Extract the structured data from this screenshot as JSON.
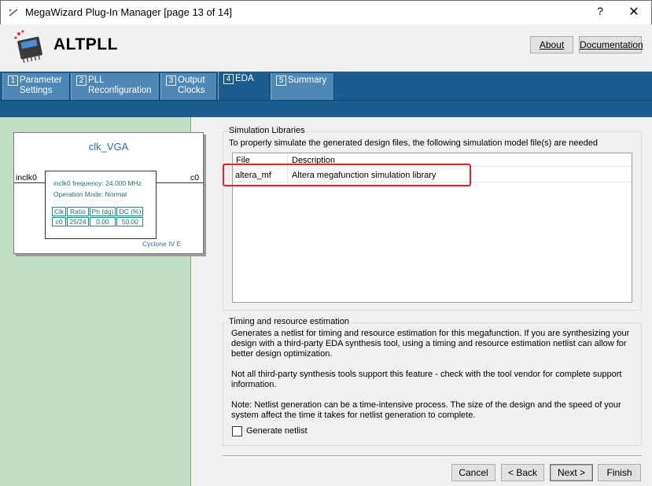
{
  "window": {
    "title": "MegaWizard Plug-In Manager [page 13 of 14]",
    "help_glyph": "?",
    "close_glyph": "✕"
  },
  "header": {
    "product": "ALTPLL",
    "about_label": "About",
    "documentation_label": "Documentation"
  },
  "tabs": [
    {
      "num": "1",
      "line1": "Parameter",
      "line2": "Settings"
    },
    {
      "num": "2",
      "line1": "PLL",
      "line2": "Reconfiguration"
    },
    {
      "num": "3",
      "line1": "Output",
      "line2": "Clocks"
    },
    {
      "num": "4",
      "line1": "EDA",
      "line2": ""
    },
    {
      "num": "5",
      "line1": "Summary",
      "line2": ""
    }
  ],
  "symbol": {
    "name": "clk_VGA",
    "input_pin": "inclk0",
    "output_pin": "c0",
    "frequency": "inclk0 frequency: 24.000 MHz",
    "mode": "Operation Mode: Normal",
    "table_headers": [
      "Clk",
      "Ratio",
      "Ph (dg)",
      "DC (%)"
    ],
    "table_row": [
      "c0",
      "25/24",
      "0.00",
      "50.00"
    ],
    "family": "Cyclone IV E"
  },
  "simulation": {
    "legend": "Simulation Libraries",
    "description": "To properly simulate the generated design files, the following simulation model file(s) are needed",
    "col_file": "File",
    "col_description": "Description",
    "rows": [
      {
        "file": "altera_mf",
        "description": "Altera megafunction simulation library"
      }
    ]
  },
  "timing": {
    "legend": "Timing and resource estimation",
    "p1": "Generates a netlist for timing and resource estimation for this megafunction. If you are synthesizing your design with a third-party EDA synthesis tool, using a timing and resource estimation netlist can allow for better design optimization.",
    "p2": "Not all third-party synthesis tools support this feature - check with the tool vendor for complete support information.",
    "p3": "Note: Netlist generation can be a time-intensive process. The size of the design and the speed of your system affect the time it takes for netlist generation to complete.",
    "checkbox_label": "Generate netlist",
    "checkbox_checked": false
  },
  "footer": {
    "cancel": "Cancel",
    "back": "< Back",
    "next": "Next >",
    "finish": "Finish"
  },
  "colors": {
    "tab_bar": "#1c5c8f",
    "tab_inactive": "#4f87b5",
    "left_panel": "#c3dfc3",
    "highlight": "#e8222a"
  }
}
